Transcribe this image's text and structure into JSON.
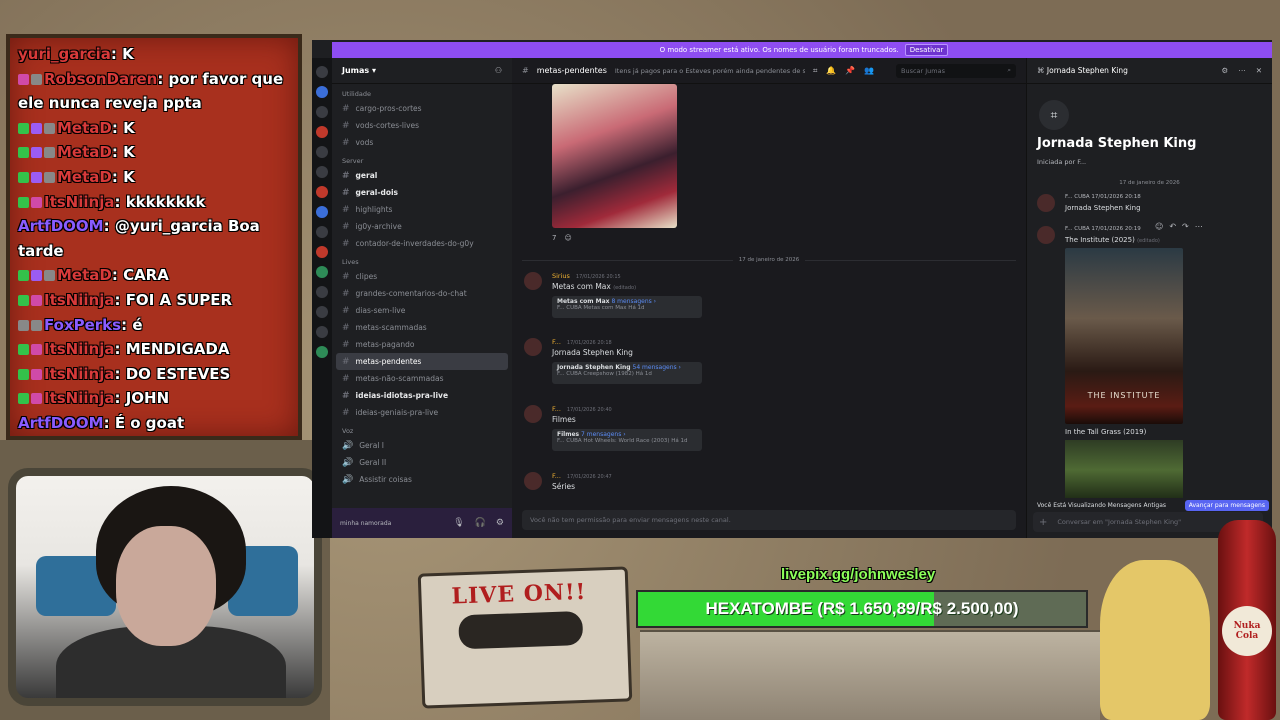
{
  "twitch_chat": [
    {
      "badges": [],
      "user": "yuri_garcia",
      "user_color": "red",
      "text": ": K"
    },
    {
      "badges": [
        "pink",
        "gray"
      ],
      "user": "RobsonDaren",
      "user_color": "red",
      "text": ": por favor que ele nunca reveja ppta"
    },
    {
      "badges": [
        "green",
        "purple",
        "gray"
      ],
      "user": "MetaD",
      "user_color": "red",
      "text": ": K"
    },
    {
      "badges": [
        "green",
        "purple",
        "gray"
      ],
      "user": "MetaD",
      "user_color": "red",
      "text": ": K"
    },
    {
      "badges": [
        "green",
        "purple",
        "gray"
      ],
      "user": "MetaD",
      "user_color": "red",
      "text": ": K"
    },
    {
      "badges": [
        "green",
        "pink"
      ],
      "user": "ItsNiinja",
      "user_color": "red",
      "text": ": kkkkkkkk"
    },
    {
      "badges": [],
      "user": "ArtfDOOM",
      "user_color": "purple",
      "text": ": @yuri_garcia Boa tarde"
    },
    {
      "badges": [
        "green",
        "purple",
        "gray"
      ],
      "user": "MetaD",
      "user_color": "red",
      "text": ": CARA"
    },
    {
      "badges": [
        "green",
        "pink"
      ],
      "user": "ItsNiinja",
      "user_color": "red",
      "text": ": FOI A SUPER"
    },
    {
      "badges": [
        "gray",
        "gray"
      ],
      "user": "FoxPerks",
      "user_color": "purple",
      "text": ": é"
    },
    {
      "badges": [
        "green",
        "pink"
      ],
      "user": "ItsNiinja",
      "user_color": "red",
      "text": ": MENDIGADA"
    },
    {
      "badges": [
        "green",
        "pink"
      ],
      "user": "ItsNiinja",
      "user_color": "red",
      "text": ": DO ESTEVES"
    },
    {
      "badges": [
        "green",
        "pink"
      ],
      "user": "ItsNiinja",
      "user_color": "red",
      "text": ": JOHN"
    },
    {
      "badges": [],
      "user": "ArtfDOOM",
      "user_color": "purple",
      "text": ": É o goat"
    }
  ],
  "discord": {
    "streamer_bar": {
      "text": "O modo streamer está ativo. Os nomes de usuário foram truncados.",
      "button": "Desativar"
    },
    "guild_name": "Jumas",
    "categories": {
      "utilidade": "Utilidade",
      "server": "Server",
      "lives": "Lives",
      "voz": "Voz"
    },
    "utilidade_channels": [
      "cargo-pros-cortes",
      "vods-cortes-lives",
      "vods"
    ],
    "server_channels": [
      {
        "name": "geral",
        "bold": true
      },
      {
        "name": "geral-dois",
        "bold": true
      },
      {
        "name": "highlights",
        "bold": false
      },
      {
        "name": "ig0y-archive",
        "bold": false
      },
      {
        "name": "contador-de-inverdades-do-g0y",
        "bold": false
      }
    ],
    "lives_channels": [
      {
        "name": "clipes",
        "bold": false,
        "active": false
      },
      {
        "name": "grandes-comentarios-do-chat",
        "bold": false,
        "active": false
      },
      {
        "name": "dias-sem-live",
        "bold": false,
        "active": false
      },
      {
        "name": "metas-scammadas",
        "bold": false,
        "active": false
      },
      {
        "name": "metas-pagando",
        "bold": false,
        "active": false
      },
      {
        "name": "metas-pendentes",
        "bold": false,
        "active": true
      },
      {
        "name": "metas-não-scammadas",
        "bold": false,
        "active": false
      },
      {
        "name": "ideias-idiotas-pra-live",
        "bold": true,
        "active": false
      },
      {
        "name": "ideias-geniais-pra-live",
        "bold": false,
        "active": false
      }
    ],
    "voice_channels": [
      "Geral I",
      "Geral II",
      "Assistir coisas"
    ],
    "user_bar_name": "minha namorada",
    "channel_header": {
      "name": "metas-pendentes",
      "topic": "Itens já pagos para o Esteves porém ainda pendentes de sere...",
      "search": "Buscar Jumas"
    },
    "cover_reactions": "7",
    "date_divider": "17 de janeiro de 2026",
    "messages": [
      {
        "name": "Sirius",
        "time": "17/01/2026 20:15",
        "text": "Metas com Max",
        "edit": "(editado)",
        "thread_title": "Metas com Max",
        "thread_count": "8 mensagens ›",
        "thread_sub": "F... CUBA Metas com Max  Há 1d",
        "name_color": "gold"
      },
      {
        "name": "F...",
        "time": "17/01/2026 20:18",
        "text": "Jornada Stephen King",
        "edit": "",
        "thread_title": "Jornada Stephen King",
        "thread_count": "54 mensagens ›",
        "thread_sub": "F... CUBA Creepshow (1982)  Há 1d",
        "name_color": "gold"
      },
      {
        "name": "F...",
        "time": "17/01/2026 20:40",
        "text": "Filmes",
        "edit": "",
        "thread_title": "Filmes",
        "thread_count": "7 mensagens ›",
        "thread_sub": "F... CUBA Hot Wheels: World Race (2003)  Há 1d",
        "name_color": "gold"
      },
      {
        "name": "F...",
        "time": "17/01/2026 20:47",
        "text": "Séries",
        "edit": "",
        "thread_title": "",
        "thread_count": "",
        "thread_sub": "",
        "name_color": "gold"
      }
    ],
    "composer_placeholder": "Você não tem permissão para enviar mensagens neste canal.",
    "thread_panel": {
      "header": "Jornada Stephen King",
      "title": "Jornada Stephen King",
      "started_by": "Iniciada por F...",
      "date": "17 de janeiro de 2026",
      "msg1_name": "F...  CUBA  17/01/2026 20:18",
      "msg1_text": "Jornada Stephen King",
      "msg2_name": "F...  CUBA  17/01/2026 20:19",
      "msg2_text": "The Institute (2025)",
      "msg2_edit": "(editado)",
      "poster_title": "THE INSTITUTE",
      "msg3_text": "In the Tall Grass (2019)",
      "old_msgs": "Você Está Visualizando Mensagens Antigas",
      "jump": "Avançar para mensagens",
      "composer_placeholder": "Conversar em \"Jornada Stephen King\""
    }
  },
  "overlay": {
    "cassette_label": "LIVE ON!!",
    "donation_url": "livepix.gg/johnwesley",
    "goal_text": "HEXATOMBE (R$ 1.650,89/R$ 2.500,00)",
    "goal_progress": 0.66,
    "bottle_label": "Nuka Cola"
  }
}
